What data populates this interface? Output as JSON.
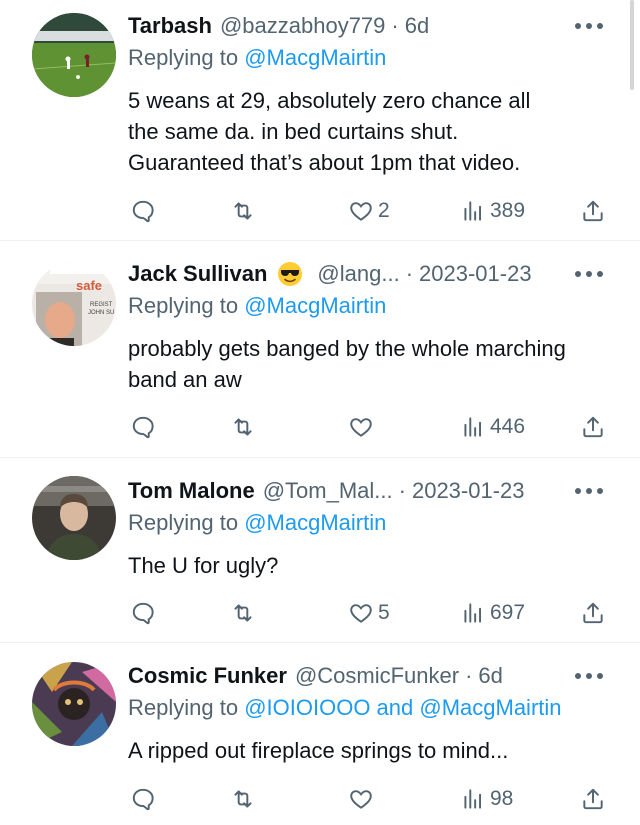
{
  "replying_to_label": "Replying to",
  "tweets": [
    {
      "name": "Tarbash",
      "handle": "@bazzabhoy779",
      "time": "6d",
      "reply_mentions": "@MacgMairtin",
      "text_lines": [
        "5 weans at 29, absolutely zero chance all",
        "the same da. in bed curtains shut.",
        "Guaranteed that’s about 1pm that video."
      ],
      "likes": "2",
      "views": "389"
    },
    {
      "name": "Jack Sullivan",
      "emoji": "sunglasses-emoji",
      "handle": "@lang...",
      "time": "2023-01-23",
      "reply_mentions": "@MacgMairtin",
      "text_lines": [
        "probably gets banged by the whole marching",
        "band an aw"
      ],
      "likes": "",
      "views": "446"
    },
    {
      "name": "Tom Malone",
      "handle": "@Tom_Mal...",
      "time": "2023-01-23",
      "reply_mentions": "@MacgMairtin",
      "text_lines": [
        "The U for ugly?"
      ],
      "likes": "5",
      "views": "697"
    },
    {
      "name": "Cosmic Funker",
      "handle": "@CosmicFunker",
      "time": "6d",
      "reply_mentions": "@IOIOIOOO and @MacgMairtin",
      "text_lines": [
        "A ripped out fireplace springs to mind..."
      ],
      "likes": "",
      "views": "98"
    }
  ],
  "avatar_text": [
    "safe",
    "REGIST",
    "JOHN SU"
  ],
  "colors": {
    "text": "#0f1419",
    "secondary": "#536471",
    "link": "#1d9bf0",
    "divider": "#eff3f4"
  }
}
